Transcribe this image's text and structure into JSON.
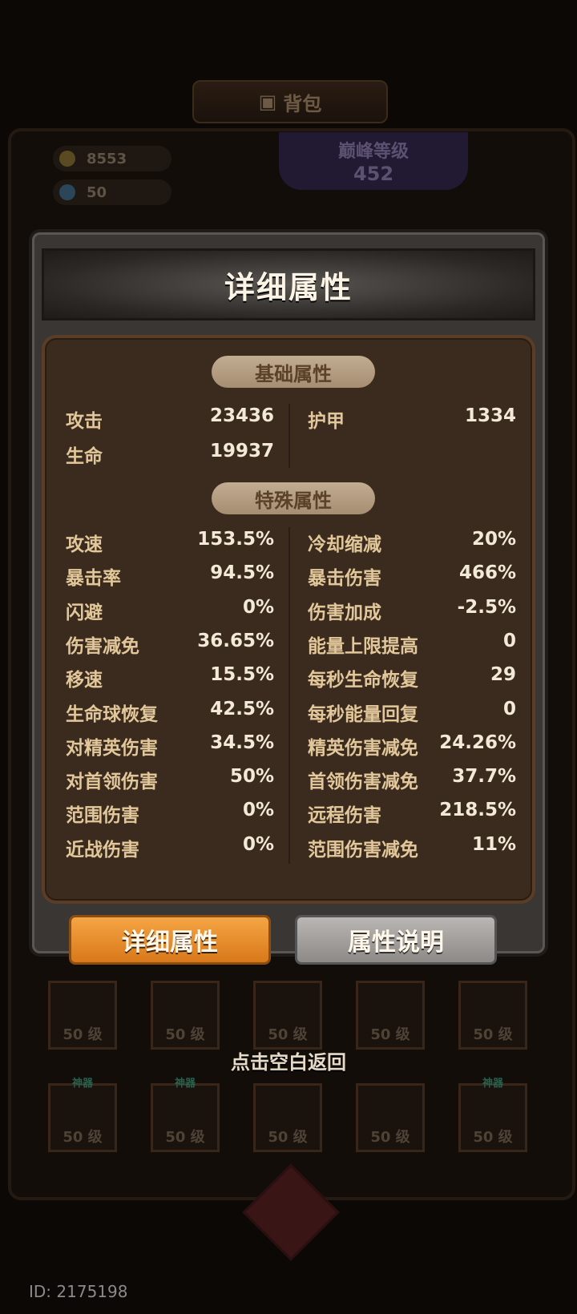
{
  "background": {
    "header_title": "背包",
    "gold": "8553",
    "gems": "50",
    "level_title": "巅峰等级",
    "level_value": "452",
    "slot_level": "50 级",
    "slot_tag": "神器"
  },
  "dialog": {
    "title": "详细属性",
    "basic_section": "基础属性",
    "special_section": "特殊属性",
    "basic": [
      {
        "label": "攻击",
        "value": "23436"
      },
      {
        "label": "护甲",
        "value": "1334"
      },
      {
        "label": "生命",
        "value": "19937"
      }
    ],
    "special_left": [
      {
        "label": "攻速",
        "value": "153.5%"
      },
      {
        "label": "暴击率",
        "value": "94.5%"
      },
      {
        "label": "闪避",
        "value": "0%"
      },
      {
        "label": "伤害减免",
        "value": "36.65%"
      },
      {
        "label": "移速",
        "value": "15.5%"
      },
      {
        "label": "生命球恢复",
        "value": "42.5%"
      },
      {
        "label": "对精英伤害",
        "value": "34.5%"
      },
      {
        "label": "对首领伤害",
        "value": "50%"
      },
      {
        "label": "范围伤害",
        "value": "0%"
      },
      {
        "label": "近战伤害",
        "value": "0%"
      }
    ],
    "special_right": [
      {
        "label": "冷却缩减",
        "value": "20%"
      },
      {
        "label": "暴击伤害",
        "value": "466%"
      },
      {
        "label": "伤害加成",
        "value": "-2.5%"
      },
      {
        "label": "能量上限提高",
        "value": "0"
      },
      {
        "label": "每秒生命恢复",
        "value": "29"
      },
      {
        "label": "每秒能量回复",
        "value": "0"
      },
      {
        "label": "精英伤害减免",
        "value": "24.26%"
      },
      {
        "label": "首领伤害减免",
        "value": "37.7%"
      },
      {
        "label": "远程伤害",
        "value": "218.5%"
      },
      {
        "label": "范围伤害减免",
        "value": "11%"
      }
    ]
  },
  "buttons": {
    "detail": "详细属性",
    "explain": "属性说明"
  },
  "hint": "点击空白返回",
  "id_text": "ID: 2175198"
}
